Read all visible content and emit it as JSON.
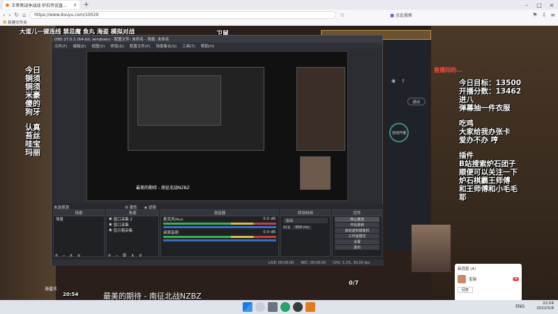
{
  "browser": {
    "tab_title": "王哥哥战争战战 炉石传说直...",
    "url": "https://www.douyu.com/10029",
    "search_placeholder": "点此搜索",
    "bookmark_label": "新建文件夹"
  },
  "stream": {
    "top_left_text": "大蛋儿一键连线 禁忌魔 鱼丸 海盗 模拟对战",
    "top_mid_text": "卫鼠",
    "left_overlay": [
      "今日",
      "铜须",
      "铜须",
      "米豪",
      "傻的",
      "狗牙",
      "认真",
      "苔丝",
      "哇宝",
      "玛丽"
    ],
    "red_note": "直播间的...",
    "right_overlay": {
      "goal": "今日目标：13500",
      "fans": "开播分数：13462",
      "line3": "进八",
      "line4": "弹幕抽一件衣服",
      "line5": "吃鸡",
      "line6": "大家给我办张卡",
      "line7": "爱办不办 哼",
      "line8": "插件",
      "line9": "B站搜索炉石团子",
      "line10": "顺便可以关注一下",
      "line11": "炉石棋霸王师傅",
      "line12": "和王师傅和小毛毛",
      "line13": "耶"
    },
    "caption": "最美的期待 - 南征北战NZBZ",
    "bottom_left": "海盗王",
    "bottom_time": "20:54",
    "counter": "0/7"
  },
  "obs": {
    "title": "OBS 27.0.1 (64-bit, windows) - 配置文件: 未命名 - 场景: 未命名",
    "menu": [
      "文件(F)",
      "编辑(E)",
      "视图(V)",
      "停靠(D)",
      "配置文件(P)",
      "场景集合(S)",
      "工具(T)",
      "帮助(H)"
    ],
    "preview_caption": "最美的期待 - 南征北战NZBZ",
    "dock_title": "未选择源",
    "dock_props": "属性",
    "dock_filters": "滤镜",
    "scenes_header": "场景",
    "scene_item": "场景",
    "sources_header": "来源",
    "sources": [
      "窗口采集 2",
      "窗口采集",
      "显示器采集"
    ],
    "mixer_header": "混音器",
    "mixer": [
      {
        "name": "麦克风/Aux",
        "db": "0.0 dB"
      },
      {
        "name": "桌面音频",
        "db": "0.0 dB"
      }
    ],
    "transition_header": "转场特效",
    "transition_type": "淡出",
    "duration_label": "时长",
    "duration_value": "300 ms",
    "controls_header": "控件",
    "controls": [
      "停止推流",
      "开始录制",
      "启动虚拟摄像机",
      "工作室模式",
      "设置",
      "退出"
    ],
    "status": [
      "LIVE: 00:00:00",
      "REC: 00:00:00",
      "CPU: 3.1%, 30.00 fps"
    ]
  },
  "panel": {
    "exit_label": "退出",
    "auto_label": "自动开播"
  },
  "notification": {
    "title": "新消息 (4)",
    "name": "宝瑞",
    "badge": "4",
    "button": "回复"
  },
  "taskbar": {
    "lang": "ENG",
    "time": "22:04",
    "date": "2022/5/8"
  }
}
